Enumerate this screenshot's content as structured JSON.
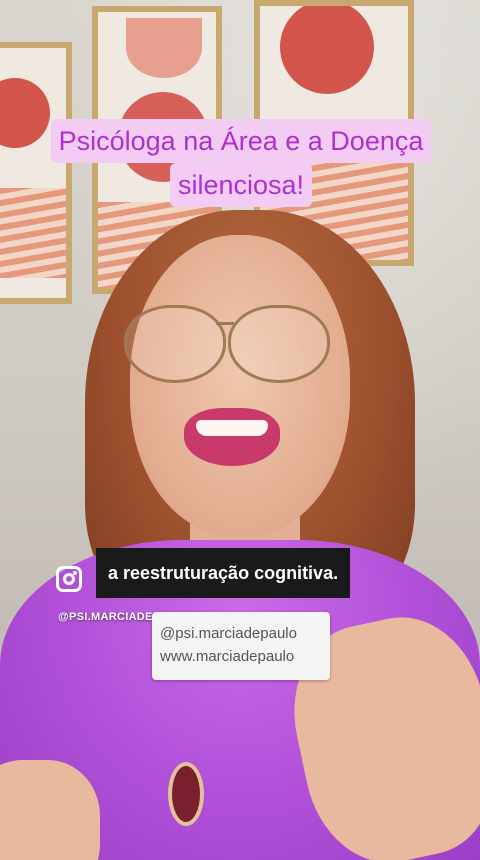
{
  "title": {
    "line1": "Psicóloga na Área e a Doença",
    "line2": "silenciosa!"
  },
  "caption": {
    "text": "a reestruturação cognitiva."
  },
  "watermark": {
    "handle": "@PSI.MARCIADEPAULO",
    "icon": "instagram-icon"
  },
  "contact_card": {
    "line1": "@psi.marciadepaulo",
    "line2": "www.marciadepaulo"
  },
  "colors": {
    "title_text": "#b02fcf",
    "title_background": "#f3ccf4",
    "caption_background": "#1a1a1a",
    "shirt": "#b151d9"
  }
}
